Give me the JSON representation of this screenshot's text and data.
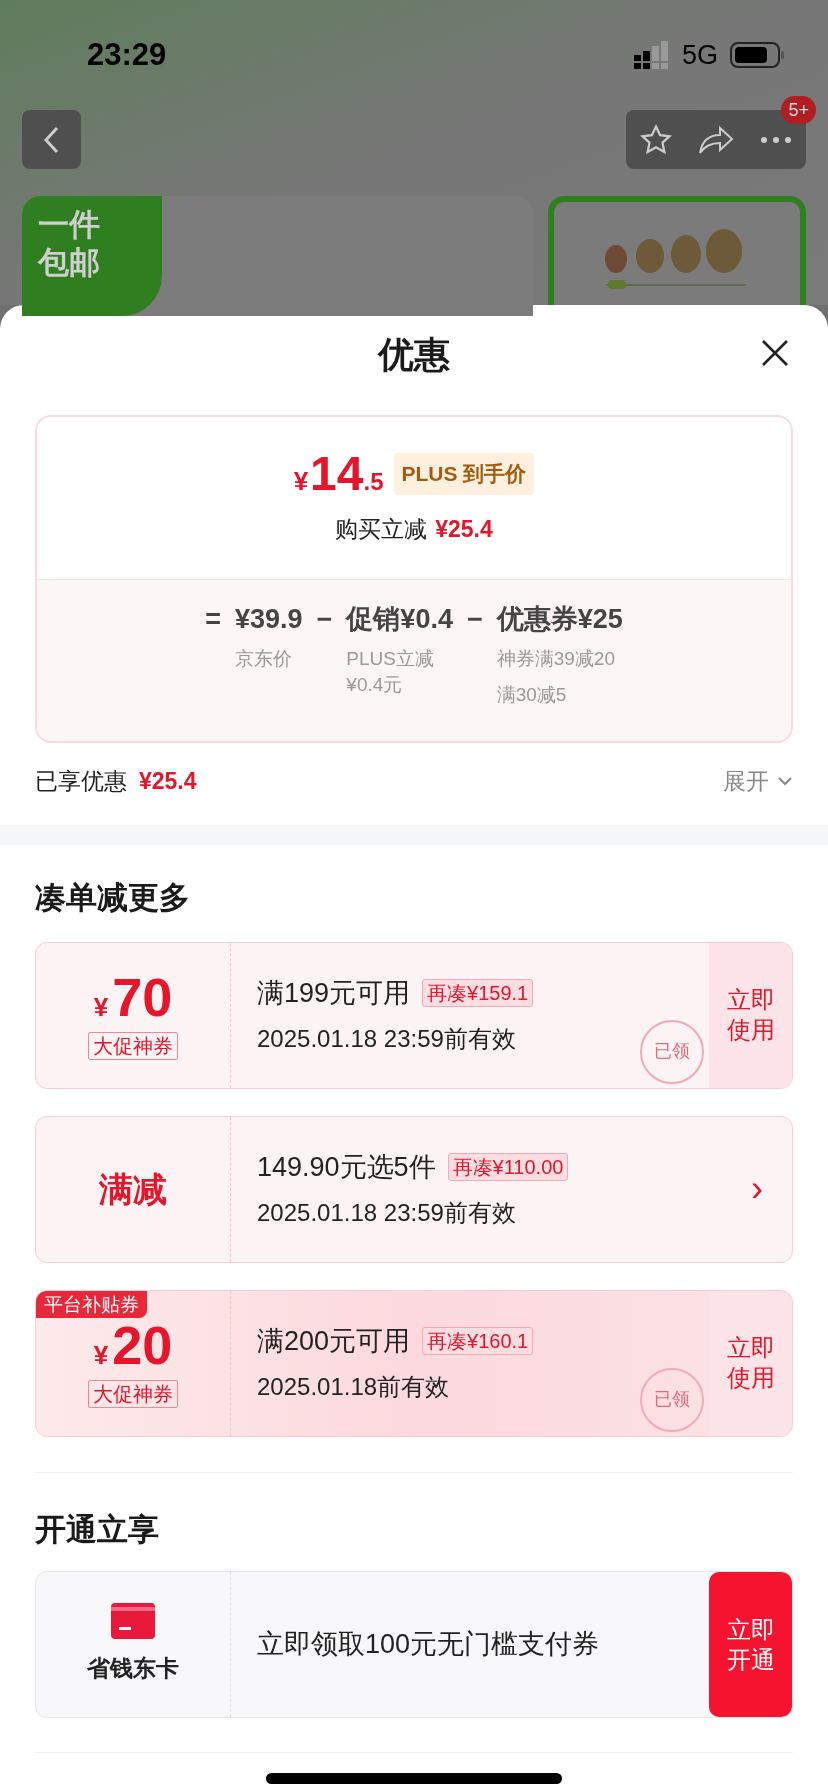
{
  "status_bar": {
    "time": "23:29",
    "network": "5G"
  },
  "nav": {
    "badge": "5+"
  },
  "banner": {
    "line1": "一件",
    "line2": "包邮"
  },
  "sheet": {
    "title": "优惠",
    "price": {
      "currency": "¥",
      "integer": "14",
      "decimal": ".5",
      "tag": "PLUS 到手价",
      "reduce_label": "购买立减",
      "reduce_value": "¥25.4"
    },
    "breakdown": [
      {
        "kind": "operator",
        "text": "="
      },
      {
        "kind": "item",
        "value": "¥39.9",
        "notes": [
          "京东价"
        ]
      },
      {
        "kind": "operator",
        "text": "−"
      },
      {
        "kind": "item",
        "value": "促销¥0.4",
        "notes": [
          "PLUS立减\n¥0.4元"
        ]
      },
      {
        "kind": "operator",
        "text": "−"
      },
      {
        "kind": "item",
        "value": "优惠券¥25",
        "notes": [
          "神券满39减20",
          "满30减5"
        ]
      }
    ],
    "enjoyed": {
      "label": "已享优惠",
      "value": "¥25.4",
      "expand": "展开"
    },
    "section1": "凑单减更多",
    "coupons": [
      {
        "kind": "amount",
        "currency": "¥",
        "amount": "70",
        "tag": "大促神券",
        "title": "满199元可用",
        "extra": "再凑¥159.1",
        "valid": "2025.01.18 23:59前有效",
        "action": [
          "立即",
          "使用"
        ],
        "stamp": "已领"
      },
      {
        "kind": "promo",
        "label": "满减",
        "title": "149.90元选5件",
        "extra": "再凑¥110.00",
        "valid": "2025.01.18 23:59前有效",
        "action": [
          "›"
        ]
      },
      {
        "kind": "amount",
        "corner": "平台补贴券",
        "currency": "¥",
        "amount": "20",
        "tag": "大促神券",
        "title": "满200元可用",
        "extra": "再凑¥160.1",
        "valid": "2025.01.18前有效",
        "action": [
          "立即",
          "使用"
        ],
        "stamp": "已领"
      }
    ],
    "section2": "开通立享",
    "offer": {
      "name": "省钱东卡",
      "text": "立即领取100元无门槛支付券",
      "action": [
        "立即",
        "开通"
      ]
    }
  }
}
